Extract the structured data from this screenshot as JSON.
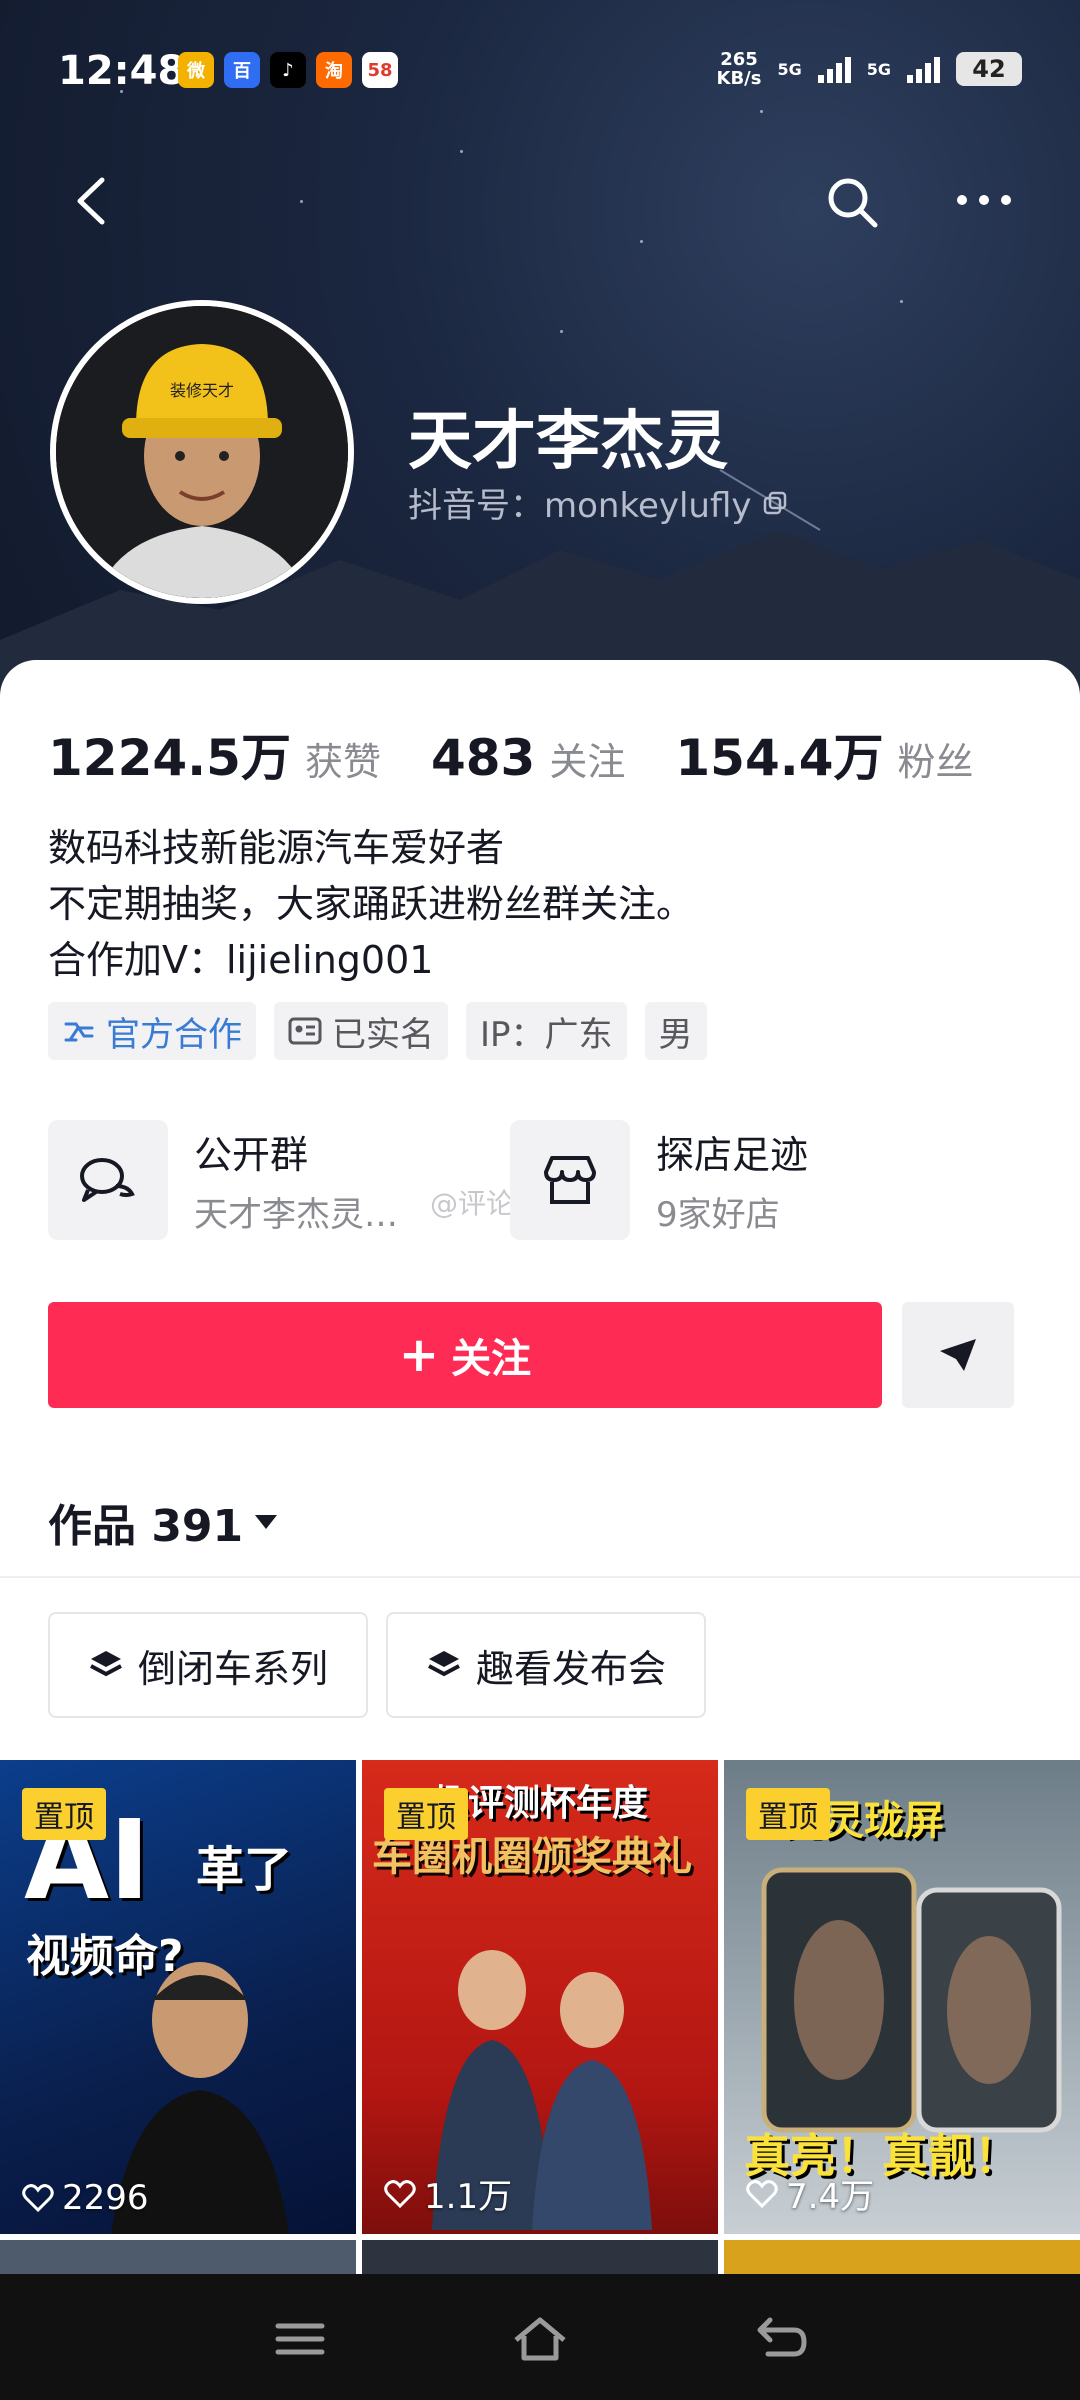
{
  "status_bar": {
    "time": "12:48",
    "apps": [
      {
        "icon": "weibo-icon",
        "color": "#f5b100",
        "glyph": "微"
      },
      {
        "icon": "baidu-icon",
        "color": "#2f6ef2",
        "glyph": "百"
      },
      {
        "icon": "tiktok-icon",
        "color": "#000000",
        "glyph": "♪"
      },
      {
        "icon": "taobao-icon",
        "color": "#ff6a00",
        "glyph": "淘"
      },
      {
        "icon": "app-58-icon",
        "color": "#ffffff",
        "glyph": "58"
      }
    ],
    "speed_value": "265",
    "speed_unit": "KB/s",
    "net1": "5G",
    "net2": "5G",
    "battery": "42"
  },
  "profile": {
    "name": "天才李杰灵",
    "douyin_id": "抖音号：monkeylufly",
    "helmet_text": "装修天才"
  },
  "stats": [
    {
      "number": "1224.5万",
      "label": "获赞"
    },
    {
      "number": "483",
      "label": "关注"
    },
    {
      "number": "154.4万",
      "label": "粉丝"
    }
  ],
  "bio": {
    "line1": "数码科技新能源汽车爱好者",
    "line2": "不定期抽奖，大家踊跃进粉丝群关注。",
    "line3": "合作加V：lijieling001"
  },
  "tags": {
    "official": "官方合作",
    "verified": "已实名",
    "ip": "IP：广东",
    "gender": "男"
  },
  "features": {
    "group_title": "公开群",
    "group_sub": "天才李杰灵…",
    "shop_title": "探店足迹",
    "shop_sub": "9家好店",
    "watermark": "@评论员石桥"
  },
  "actions": {
    "follow": "关注",
    "follow_plus": "+"
  },
  "works": {
    "label": "作品 391"
  },
  "collections": [
    "倒闭车系列",
    "趣看发布会"
  ],
  "videos": [
    {
      "pin": "置顶",
      "likes": "2296",
      "title": "AI革了视频命?"
    },
    {
      "pin": "置顶",
      "likes": "1.1万",
      "title": "趣评测杯年度"
    },
    {
      "pin": "置顶",
      "likes": "7.4万",
      "title": "真亮！真靓！"
    }
  ],
  "colors": {
    "follow_button": "#fe2c55",
    "pin_badge": "#fbcf2d",
    "official_tag": "#3a7bd5"
  }
}
